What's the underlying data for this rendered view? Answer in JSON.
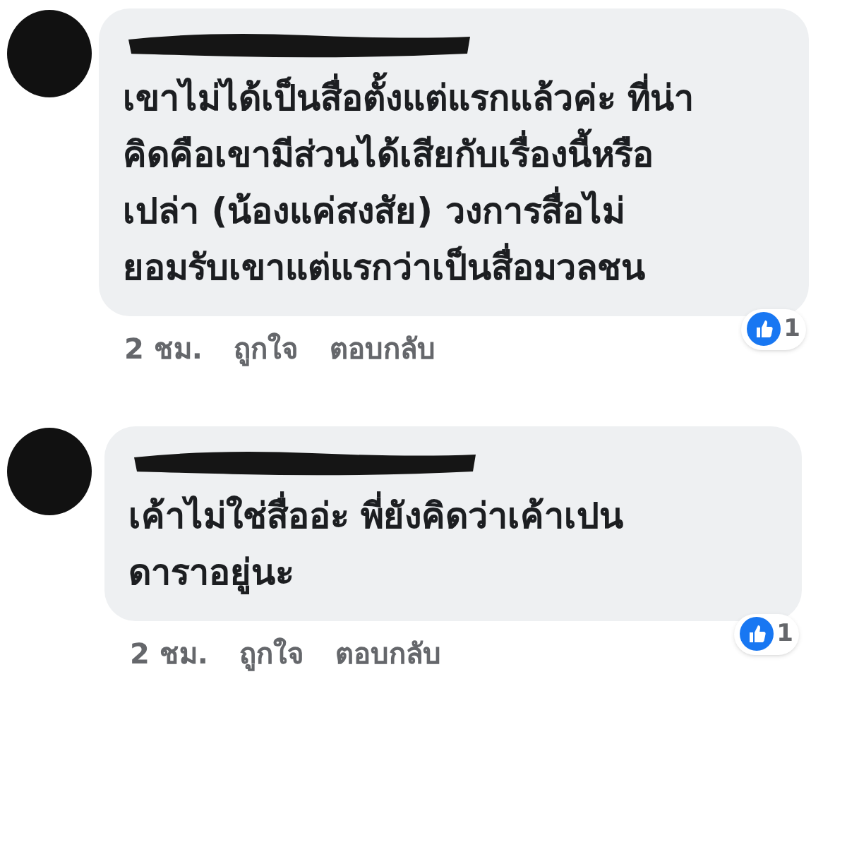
{
  "comments": [
    {
      "text_lines": [
        "เขาไม่ได้เป็นสื่อตั้งแต่แรกแล้วค่ะ ที่น่า",
        "คิดคือเขามีส่วนได้เสียกับเรื่องนี้หรือ",
        "เปล่า (น้องแค่สงสัย) วงการสื่อไม่",
        "ยอมรับเขาแต่แรกว่าเป็นสื่อมวลชน"
      ],
      "time": "2 ชม.",
      "actions": [
        "ถูกใจ",
        "ตอบกลับ"
      ],
      "reaction_count": "1"
    },
    {
      "text_lines": [
        "เค้าไม่ใช่สื่ออ่ะ พี่ยังคิดว่าเค้าเปน",
        "ดาราอยู่นะ"
      ],
      "time": "2 ชม.",
      "actions": [
        "ถูกใจ",
        "ตอบกลับ"
      ],
      "reaction_count": "1"
    }
  ]
}
